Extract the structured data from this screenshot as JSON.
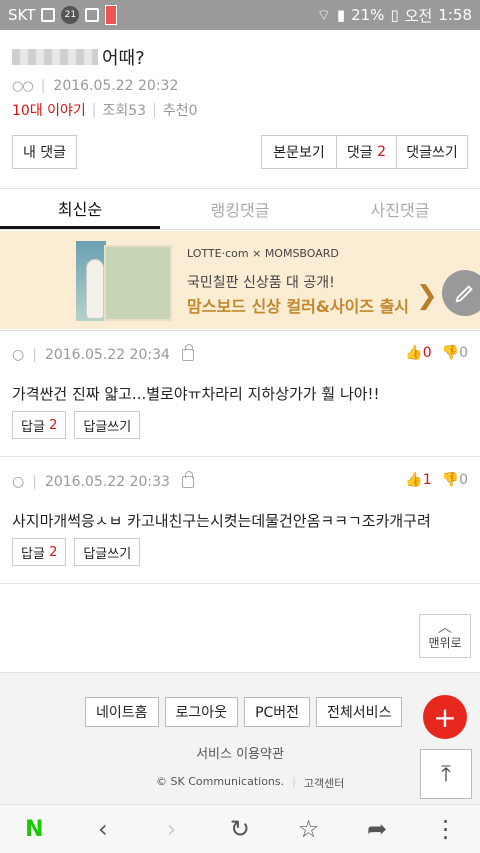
{
  "status_bar": {
    "carrier": "SKT",
    "notif_count": "21",
    "battery": "21%",
    "ampm": "오전",
    "time": "1:58"
  },
  "post": {
    "title_suffix": "어때?",
    "author": "○○",
    "datetime": "2016.05.22 20:32",
    "category": "10대 이야기",
    "views": "조회53",
    "recommend": "추천0"
  },
  "buttons": {
    "my_comments": "내 댓글",
    "view_post": "본문보기",
    "comments_label": "댓글",
    "comments_count": "2",
    "write_comment": "댓글쓰기"
  },
  "tabs": [
    {
      "label": "최신순",
      "active": true
    },
    {
      "label": "랭킹댓글",
      "active": false
    },
    {
      "label": "사진댓글",
      "active": false
    }
  ],
  "banner": {
    "logo_lotte": "LOTTE·com",
    "logo_x": "×",
    "logo_moms": "MOMSBOARD",
    "line1": "국민칠판 신상품 대 공개!",
    "line2": "맘스보드 신상 컬러&사이즈 출시",
    "arrow": "❯"
  },
  "comments": [
    {
      "author": "○",
      "datetime": "2016.05.22 20:34",
      "up": "0",
      "down": "0",
      "text": "가격싼건 진짜 얇고...별로야ㅠ차라리 지하상가가 훨 나아!!",
      "reply_label": "답글",
      "reply_count": "2",
      "write_reply": "답글쓰기"
    },
    {
      "author": "○",
      "datetime": "2016.05.22 20:33",
      "up": "1",
      "down": "0",
      "text": "사지마개썩응ㅅㅂ 카고내친구는시켯는데물건안옴ㅋㅋㄱ조카개구려",
      "reply_label": "답글",
      "reply_count": "2",
      "write_reply": "답글쓰기"
    }
  ],
  "to_top": {
    "label": "맨위로",
    "chevron": "︿"
  },
  "footer": {
    "buttons": [
      "네이트홈",
      "로그아웃",
      "PC버전",
      "전체서비스"
    ],
    "terms": "서비스 이용약관",
    "copyright": "© SK Communications.",
    "support": "고객센터"
  },
  "icons": {
    "plus": "+",
    "scroll_up": "⤒"
  },
  "nav": {
    "logo": "N",
    "back": "‹",
    "forward": "›",
    "refresh": "↻",
    "bookmark": "☆",
    "share": "➦",
    "menu": "⋮"
  },
  "colors": {
    "accent_red": "#d11111",
    "fab_red": "#e7281e",
    "naver_green": "#1ec800",
    "banner_bg": "#fbecd4"
  }
}
